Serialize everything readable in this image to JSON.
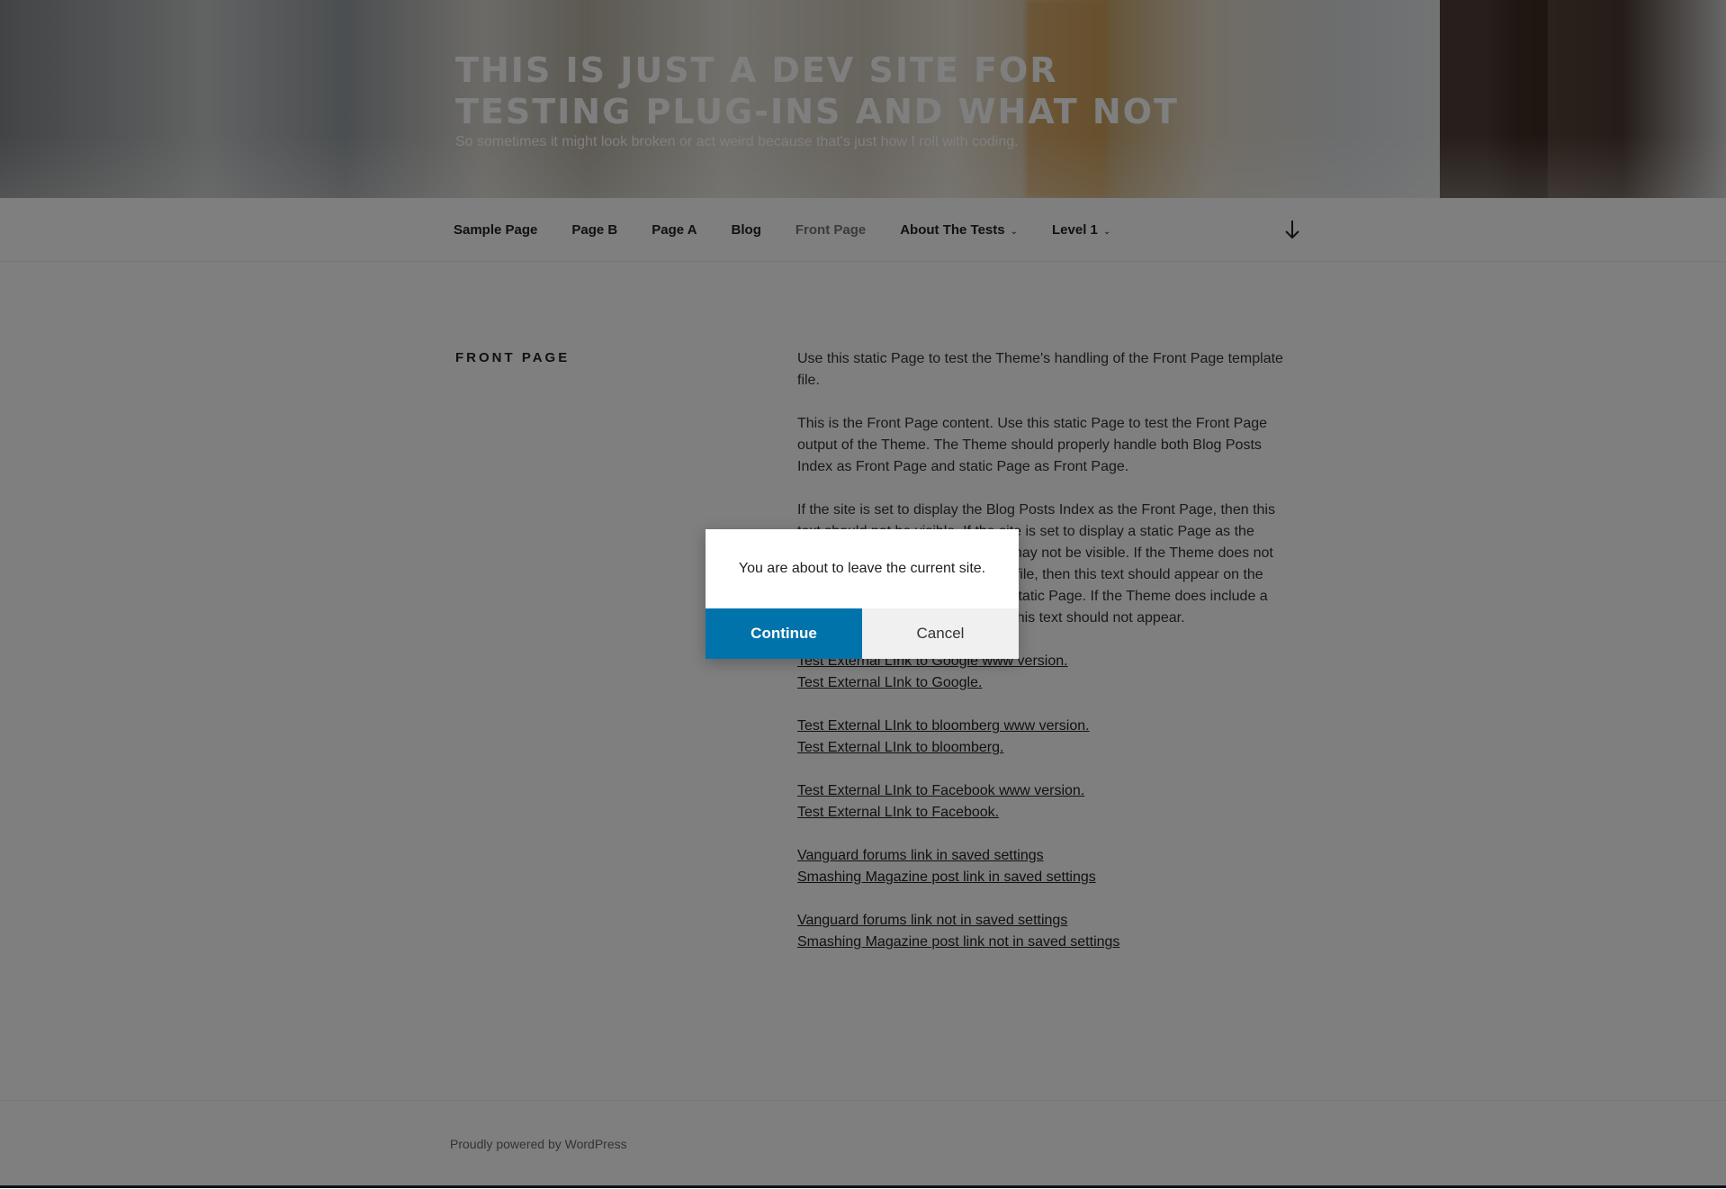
{
  "site": {
    "title": "THIS IS JUST A DEV SITE FOR TESTING PLUG-INS AND WHAT NOT",
    "description": "So sometimes it might look broken or act weird because that's just how I roll with coding."
  },
  "nav": {
    "items": [
      {
        "label": "Sample Page"
      },
      {
        "label": "Page B"
      },
      {
        "label": "Page A"
      },
      {
        "label": "Blog"
      },
      {
        "label": "Front Page",
        "current": true
      },
      {
        "label": "About The Tests",
        "has_children": true
      },
      {
        "label": "Level 1",
        "has_children": true
      }
    ],
    "scroll_icon": "arrow-down-icon"
  },
  "page": {
    "title": "FRONT PAGE",
    "paragraphs": [
      "Use this static Page to test the Theme's handling of the Front Page template file.",
      "This is the Front Page content. Use this static Page to test the Front Page output of the Theme. The Theme should properly handle both Blog Posts Index as Front Page and static Page as Front Page.",
      "If the site is set to display the Blog Posts Index as the Front Page, then this text should not be visible. If the site is set to display a static Page as the Front Page, then this text may or may not be visible. If the Theme does not include a front-page.php template file, then this text should appear on the Front Page when set to display a static Page. If the Theme does include a front-page.php template file, then this text should not appear."
    ],
    "link_groups": [
      [
        "Test External LInk to Google www version.",
        "Test External LInk to Google."
      ],
      [
        "Test External LInk to bloomberg www version.",
        "Test External LInk to bloomberg."
      ],
      [
        "Test External LInk to Facebook www version.",
        "Test External LInk to Facebook."
      ],
      [
        "Vanguard forums link in saved settings",
        "Smashing Magazine post link in saved settings"
      ],
      [
        "Vanguard forums link not in saved settings",
        "Smashing Magazine post link not in saved settings"
      ]
    ]
  },
  "footer": {
    "text": "Proudly powered by WordPress"
  },
  "dialog": {
    "message": "You are about to leave the current site.",
    "continue_label": "Continue",
    "cancel_label": "Cancel"
  },
  "colors": {
    "continue_button": "#0073aa",
    "overlay": "rgba(0,0,0,0.5)"
  }
}
